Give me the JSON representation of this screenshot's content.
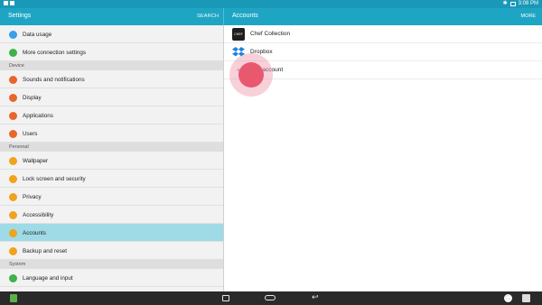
{
  "status_bar": {
    "time": "3:08 PM",
    "bluetooth_glyph": "✱"
  },
  "header": {
    "left_title": "Settings",
    "search_label": "SEARCH",
    "right_title": "Accounts",
    "more_label": "MORE"
  },
  "colors": {
    "header": "#1fa5c4",
    "status_bar": "#1a98b8",
    "active_row": "#9edbe6",
    "touch_dot": "#e8586f"
  },
  "settings": {
    "rows_top": [
      {
        "label": "Data usage",
        "icon": "data-usage-icon",
        "color": "#3a9ee8"
      },
      {
        "label": "More connection settings",
        "icon": "connection-icon",
        "color": "#3fb24a"
      }
    ],
    "section_device": "Device",
    "rows_device": [
      {
        "label": "Sounds and notifications",
        "icon": "sound-icon",
        "color": "#e8662a"
      },
      {
        "label": "Display",
        "icon": "display-icon",
        "color": "#e8662a"
      },
      {
        "label": "Applications",
        "icon": "applications-icon",
        "color": "#e8662a"
      },
      {
        "label": "Users",
        "icon": "users-icon",
        "color": "#e8662a"
      }
    ],
    "section_personal": "Personal",
    "rows_personal": [
      {
        "label": "Wallpaper",
        "icon": "wallpaper-icon",
        "color": "#f0a31c"
      },
      {
        "label": "Lock screen and security",
        "icon": "lock-icon",
        "color": "#f0a31c"
      },
      {
        "label": "Privacy",
        "icon": "privacy-icon",
        "color": "#f0a31c"
      },
      {
        "label": "Accessibility",
        "icon": "accessibility-icon",
        "color": "#f0a31c"
      },
      {
        "label": "Accounts",
        "icon": "accounts-icon",
        "color": "#f0a31c",
        "active": true
      },
      {
        "label": "Backup and reset",
        "icon": "backup-icon",
        "color": "#f0a31c"
      }
    ],
    "section_system": "System",
    "rows_system": [
      {
        "label": "Language and input",
        "icon": "language-icon",
        "color": "#3fb24a"
      }
    ]
  },
  "accounts": [
    {
      "label": "Chef Collection",
      "icon": "chef-collection-icon"
    },
    {
      "label": "Dropbox",
      "icon": "dropbox-icon"
    },
    {
      "label": "Add account",
      "icon": "plus-icon"
    }
  ],
  "chef_icon_text": "CHEF"
}
